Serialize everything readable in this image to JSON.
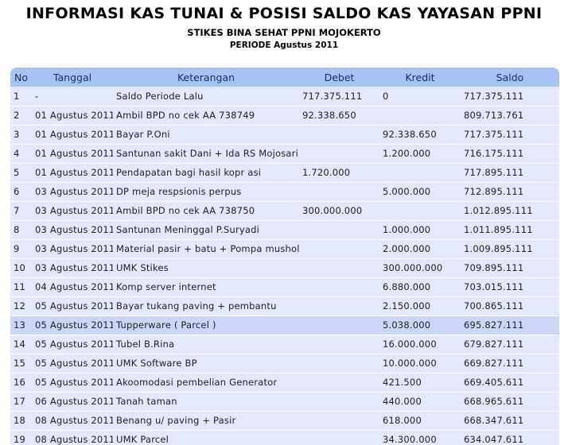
{
  "header": {
    "title": "INFORMASI KAS TUNAI & POSISI SALDO KAS YAYASAN PPNI",
    "subtitle": "STIKES BINA SEHAT PPNI MOJOKERTO",
    "period": "PERIODE Agustus 2011"
  },
  "table": {
    "columns": [
      "No",
      "Tanggal",
      "Keterangan",
      "Debet",
      "Kredit",
      "Saldo"
    ],
    "rows": [
      {
        "no": "1",
        "tanggal": "-",
        "keterangan": "Saldo Periode Lalu",
        "debet": "717.375.111",
        "kredit": "0",
        "saldo": "717.375.111"
      },
      {
        "no": "2",
        "tanggal": "01 Agustus 2011",
        "keterangan": "Ambil BPD no cek AA 738749",
        "debet": "92.338.650",
        "kredit": "",
        "saldo": "809.713.761"
      },
      {
        "no": "3",
        "tanggal": "01 Agustus 2011",
        "keterangan": "Bayar P.Oni",
        "debet": "",
        "kredit": "92.338.650",
        "saldo": "717.375.111"
      },
      {
        "no": "4",
        "tanggal": "01 Agustus 2011",
        "keterangan": "Santunan sakit Dani + Ida RS Mojosari",
        "debet": "",
        "kredit": "1.200.000",
        "saldo": "716.175.111"
      },
      {
        "no": "5",
        "tanggal": "01 Agustus 2011",
        "keterangan": "Pendapatan bagi hasil kopr asi",
        "debet": "1.720.000",
        "kredit": "",
        "saldo": "717.895.111"
      },
      {
        "no": "6",
        "tanggal": "03 Agustus 2011",
        "keterangan": "DP meja respsionis perpus",
        "debet": "",
        "kredit": "5.000.000",
        "saldo": "712.895.111"
      },
      {
        "no": "7",
        "tanggal": "03 Agustus 2011",
        "keterangan": "Ambil BPD no cek AA 738750",
        "debet": "300.000.000",
        "kredit": "",
        "saldo": "1.012.895.111"
      },
      {
        "no": "8",
        "tanggal": "03 Agustus 2011",
        "keterangan": "Santunan Meninggal P.Suryadi",
        "debet": "",
        "kredit": "1.000.000",
        "saldo": "1.011.895.111"
      },
      {
        "no": "9",
        "tanggal": "03 Agustus 2011",
        "keterangan": "Material pasir + batu + Pompa musholah",
        "debet": "",
        "kredit": "2.000.000",
        "saldo": "1.009.895.111"
      },
      {
        "no": "10",
        "tanggal": "03 Agustus 2011",
        "keterangan": "UMK Stikes",
        "debet": "",
        "kredit": "300.000.000",
        "saldo": "709.895.111"
      },
      {
        "no": "11",
        "tanggal": "04 Agustus 2011",
        "keterangan": "Komp server internet",
        "debet": "",
        "kredit": "6.880.000",
        "saldo": "703.015.111"
      },
      {
        "no": "12",
        "tanggal": "05 Agustus 2011",
        "keterangan": "Bayar tukang paving + pembantu",
        "debet": "",
        "kredit": "2.150.000",
        "saldo": "700.865.111"
      },
      {
        "no": "13",
        "tanggal": "05 Agustus 2011",
        "keterangan": "Tupperware ( Parcel )",
        "debet": "",
        "kredit": "5.038.000",
        "saldo": "695.827.111"
      },
      {
        "no": "14",
        "tanggal": "05 Agustus 2011",
        "keterangan": "Tubel B.Rina",
        "debet": "",
        "kredit": "16.000.000",
        "saldo": "679.827.111"
      },
      {
        "no": "15",
        "tanggal": "05 Agustus 2011",
        "keterangan": "UMK Software BP",
        "debet": "",
        "kredit": "10.000.000",
        "saldo": "669.827.111"
      },
      {
        "no": "16",
        "tanggal": "05 Agustus 2011",
        "keterangan": "Akoomodasi pembelian Generator",
        "debet": "",
        "kredit": "421.500",
        "saldo": "669.405.611"
      },
      {
        "no": "17",
        "tanggal": "06 Agustus 2011",
        "keterangan": "Tanah taman",
        "debet": "",
        "kredit": "440.000",
        "saldo": "668.965.611"
      },
      {
        "no": "18",
        "tanggal": "08 Agustus 2011",
        "keterangan": "Benang u/ paving + Pasir",
        "debet": "",
        "kredit": "618.000",
        "saldo": "668.347.611"
      },
      {
        "no": "19",
        "tanggal": "08 Agustus 2011",
        "keterangan": "UMK Parcel",
        "debet": "",
        "kredit": "34.300.000",
        "saldo": "634.047.611"
      }
    ]
  },
  "colors": {
    "header_bg": "#a6c4f3",
    "row_bg": "#e3e8fb",
    "row_highlight_bg": "#ccd7f7"
  },
  "highlighted_row": "13"
}
